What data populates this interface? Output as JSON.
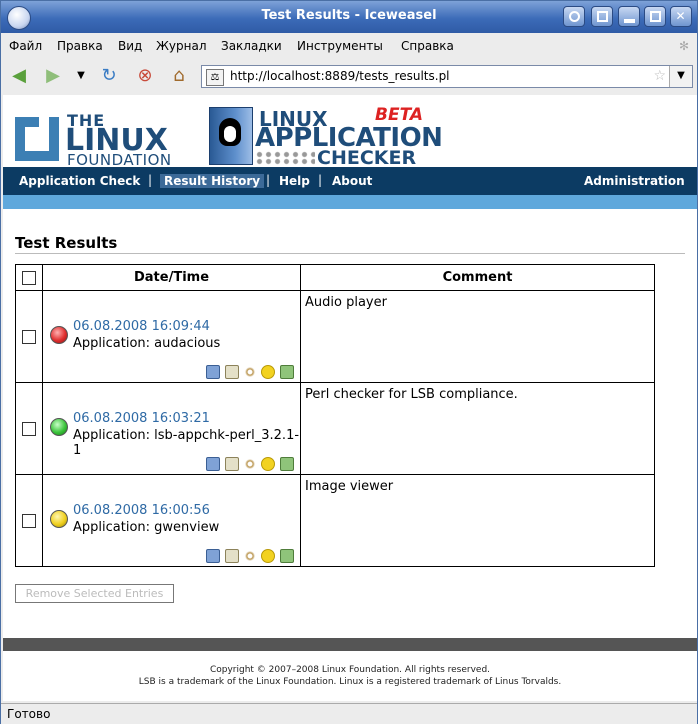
{
  "window": {
    "title": "Test Results - Iceweasel"
  },
  "menu": [
    {
      "label": "Файл"
    },
    {
      "label": "Правка"
    },
    {
      "label": "Вид"
    },
    {
      "label": "Журнал"
    },
    {
      "label": "Закладки"
    },
    {
      "label": "Инструменты"
    },
    {
      "label": "Справка"
    }
  ],
  "address": {
    "url": "http://localhost:8889/tests_results.pl"
  },
  "branding": {
    "lf_the": "THE",
    "lf_linux": "LINUX",
    "lf_foundation": "FOUNDATION",
    "app_linux": "LINUX",
    "app_application": "APPLICATION",
    "app_checker": "CHECKER",
    "app_beta": "BETA"
  },
  "nav": {
    "items": [
      {
        "label": "Application Check"
      },
      {
        "label": "Result History"
      },
      {
        "label": "Help"
      },
      {
        "label": "About"
      }
    ],
    "separator": "|",
    "admin": "Administration"
  },
  "page": {
    "title": "Test Results"
  },
  "table": {
    "headers": [
      "Date/Time",
      "Comment"
    ],
    "rows": [
      {
        "date": "06.08.2008 16:09:44",
        "app": "Application: audacious",
        "comment": "Audio player",
        "status": "red"
      },
      {
        "date": "06.08.2008 16:03:21",
        "app": "Application: lsb-appchk-perl_3.2.1-1",
        "comment": "Perl checker for LSB compliance.",
        "status": "green"
      },
      {
        "date": "06.08.2008 16:00:56",
        "app": "Application: gwenview",
        "comment": "Image viewer",
        "status": "yellow"
      }
    ]
  },
  "remove_button": "Remove Selected Entries",
  "footer": {
    "line1": "Copyright © 2007–2008 Linux Foundation. All rights reserved.",
    "line2": "LSB is a trademark of the Linux Foundation. Linux is a registered trademark of Linus Torvalds."
  },
  "status_bar": "Готово",
  "colors": {
    "red": "#e03030",
    "green": "#3cc43c",
    "yellow": "#f0d020",
    "nav_bg": "#0c3b63",
    "link": "#2f6aa5"
  }
}
